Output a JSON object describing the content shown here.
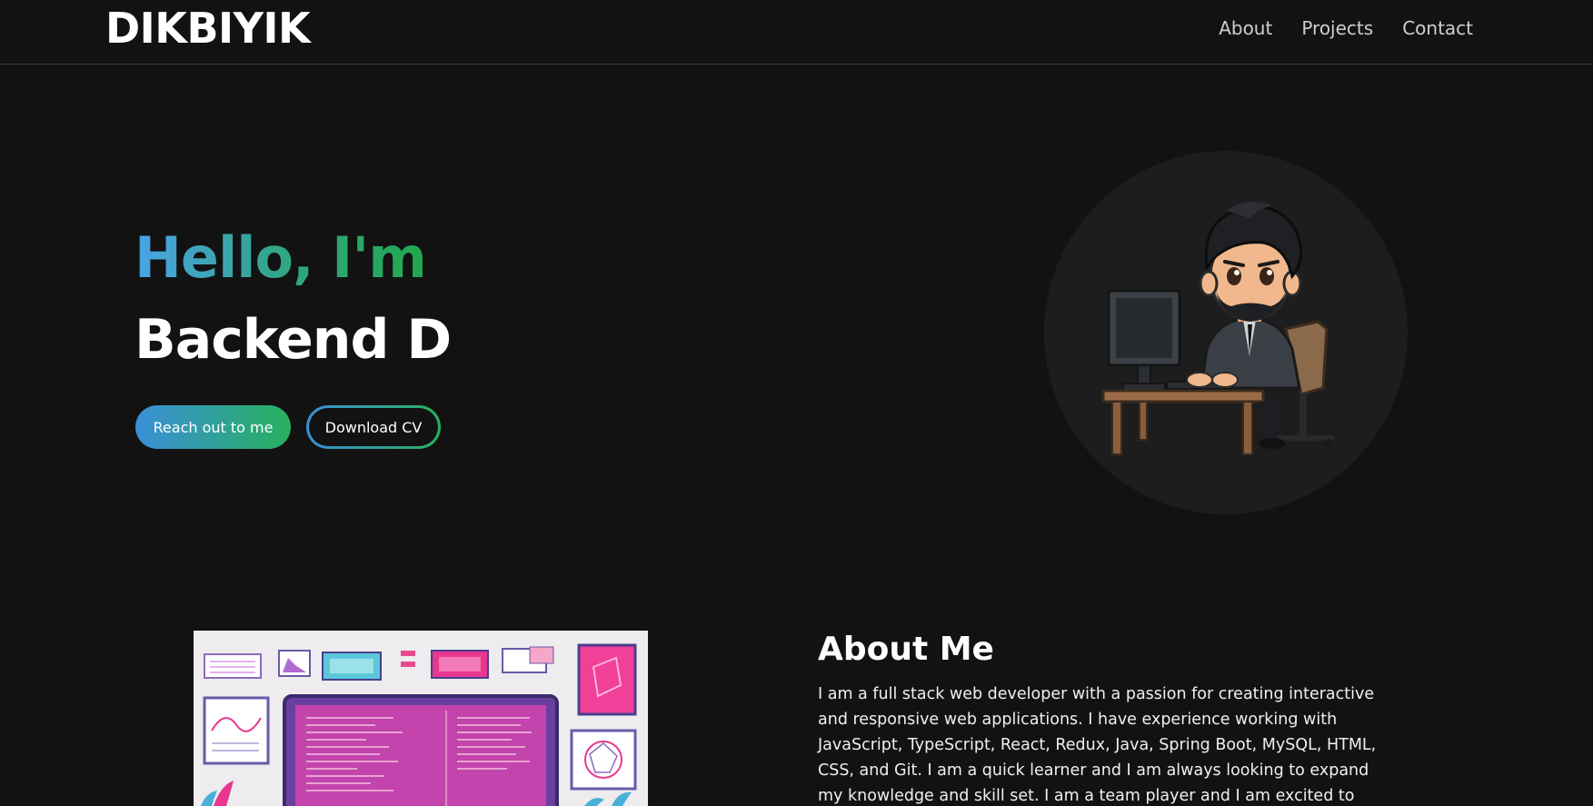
{
  "header": {
    "logo": "DIKBIYIK",
    "nav": [
      "About",
      "Projects",
      "Contact"
    ]
  },
  "hero": {
    "greeting": "Hello, I'm",
    "role": "Backend D",
    "primary_button": "Reach out to me",
    "secondary_button": "Download CV"
  },
  "about": {
    "title": "About Me",
    "text": "I am a full stack web developer with a passion for creating interactive and responsive web applications. I have experience working with JavaScript, TypeScript, React, Redux, Java, Spring Boot, MySQL, HTML, CSS, and Git. I am a quick learner and I am always looking to expand my knowledge and skill set. I am a team player and I am excited to work with"
  },
  "colors": {
    "background": "#121212",
    "gradient_start": "#3a8fd8",
    "gradient_end": "#27b15d",
    "accent_pink": "#e8378f"
  },
  "icons": {
    "avatar": "developer-avatar-illustration",
    "about_image": "workspace-illustration"
  }
}
